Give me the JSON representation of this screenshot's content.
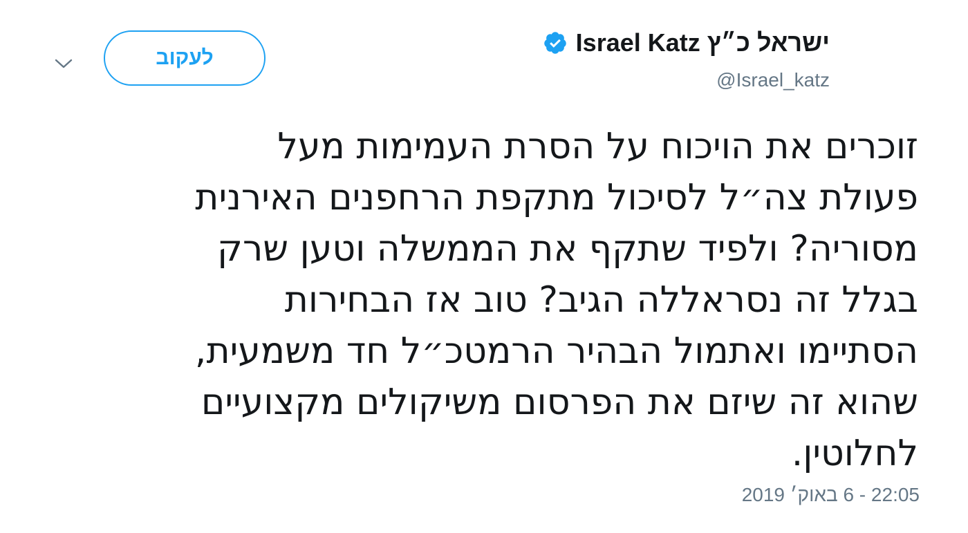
{
  "author": {
    "display_name": "ישראל כ״ץ Israel Katz",
    "handle": "@Israel_katz",
    "verified_icon": "verified-badge-icon"
  },
  "actions": {
    "follow_label": "לעקוב",
    "menu_icon": "chevron-down-icon"
  },
  "tweet": {
    "lines": [
      "זוכרים את הויכוח על הסרת העמימות מעל",
      "פעולת צה״ל לסיכול מתקפת הרחפנים האירנית",
      "מסוריה? ולפיד שתקף את הממשלה וטען שרק",
      "בגלל זה נסראללה הגיב? טוב אז הבחירות",
      "הסתיימו ואתמול הבהיר הרמטכ״ל חד משמעית,",
      "שהוא זה שיזם את הפרסום משיקולים מקצועיים",
      "לחלוטין."
    ],
    "timestamp": "22:05 - 6 באוק׳ 2019"
  },
  "colors": {
    "accent": "#1da1f2",
    "secondary_text": "#657786",
    "primary_text": "#14171a"
  }
}
